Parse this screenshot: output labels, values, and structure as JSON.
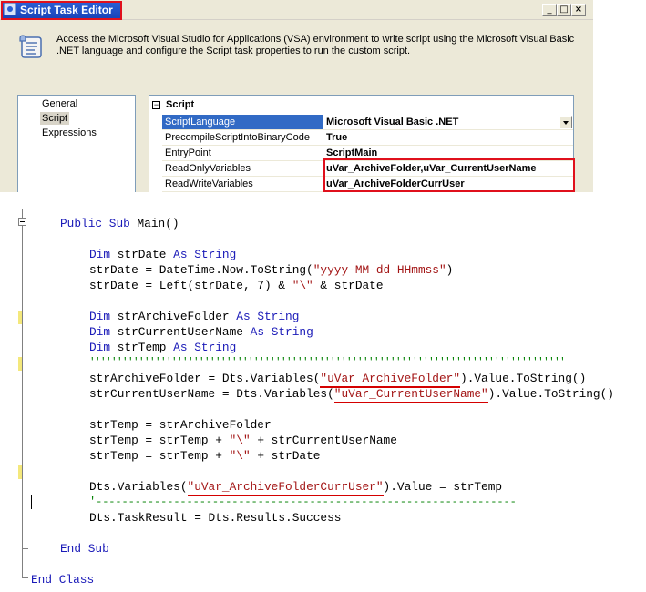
{
  "window": {
    "title": "Script Task Editor",
    "controls": {
      "minimize": "_",
      "maximize": "□",
      "close": "×"
    }
  },
  "description": "Access the Microsoft Visual Studio for Applications (VSA) environment to write script using the Microsoft Visual Basic .NET language and configure the Script task properties to run the custom script.",
  "nav": [
    "General",
    "Script",
    "Expressions"
  ],
  "grid": {
    "section": "Script",
    "rows": [
      {
        "name": "ScriptLanguage",
        "value": "Microsoft Visual Basic .NET"
      },
      {
        "name": "PrecompileScriptIntoBinaryCode",
        "value": "True"
      },
      {
        "name": "EntryPoint",
        "value": "ScriptMain"
      },
      {
        "name": "ReadOnlyVariables",
        "value": "uVar_ArchiveFolder,uVar_CurrentUserName"
      },
      {
        "name": "ReadWriteVariables",
        "value": "uVar_ArchiveFolderCurrUser"
      }
    ]
  },
  "code": {
    "kw": {
      "public": "Public",
      "sub": "Sub",
      "dim": "Dim",
      "as": "As",
      "string": "String",
      "end": "End",
      "class": "Class"
    },
    "main_sig": " Main()",
    "l_dim_date_name": " strDate ",
    "l_strdate1_a": "strDate = DateTime.Now.ToString(",
    "l_strdate1_s": "\"yyyy-MM-dd-HHmmss\"",
    "l_strdate1_b": ")",
    "l_strdate2_a": "strDate = Left(strDate, 7) & ",
    "l_strdate2_s": "\"\\\"",
    "l_strdate2_b": " & strDate",
    "l_dim_archive_name": " strArchiveFolder ",
    "l_dim_user_name": " strCurrentUserName ",
    "l_dim_temp_name": " strTemp ",
    "separator_quotes": "'''''''''''''''''''''''''''''''''''''''''''''''''''''''''''''''''''''''''''''''''''''''",
    "l_arch_a": "strArchiveFolder = Dts.Variables(",
    "l_arch_s": "\"uVar_ArchiveFolder\"",
    "l_arch_b": ").Value.ToString()",
    "l_user_a": "strCurrentUserName = Dts.Variables(",
    "l_user_s": "\"uVar_CurrentUserName\"",
    "l_user_b": ").Value.ToString()",
    "l_temp1": "strTemp = strArchiveFolder",
    "l_temp2_a": "strTemp = strTemp + ",
    "l_temp2_s": "\"\\\"",
    "l_temp2_b": " + strCurrentUserName",
    "l_temp3_a": "strTemp = strTemp + ",
    "l_temp3_s": "\"\\\"",
    "l_temp3_b": " + strDate",
    "l_set_a": "Dts.Variables(",
    "l_set_s": "\"uVar_ArchiveFolderCurrUser\"",
    "l_set_b": ").Value = strTemp",
    "separator_dashes": "'-----------------------------------------------------------------",
    "l_result": "Dts.TaskResult = Dts.Results.Success"
  },
  "colors": {
    "keyword": "#1a1ab8",
    "string": "#a31515",
    "comment": "#008000",
    "highlight": "#e0101c",
    "selection": "#316ac5"
  }
}
